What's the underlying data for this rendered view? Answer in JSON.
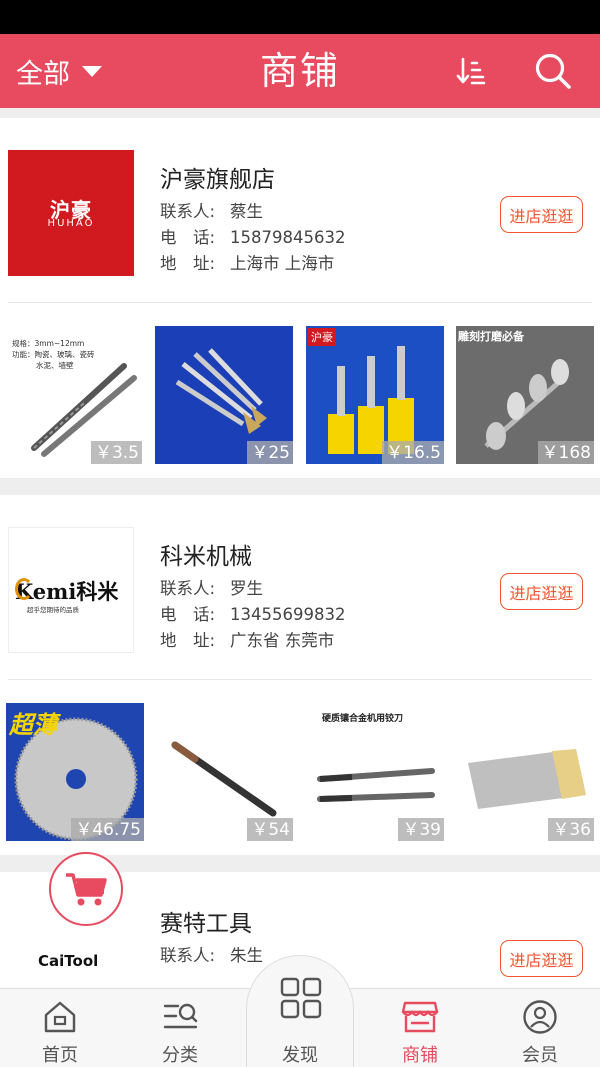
{
  "header": {
    "filter_label": "全部",
    "title": "商铺"
  },
  "colors": {
    "brand": "#e84a5f",
    "accent_orange": "#f0562f"
  },
  "shops": [
    {
      "name": "沪豪旗舰店",
      "logo_text": "沪豪",
      "logo_subtext": "HUHAO",
      "contact_label": "联系人:",
      "contact": "蔡生",
      "phone_label": "电　话:",
      "phone": "15879845632",
      "address_label": "地　址:",
      "address": "上海市 上海市",
      "enter_label": "进店逛逛",
      "products": [
        {
          "price": "￥3.5"
        },
        {
          "price": "￥25"
        },
        {
          "price": "￥16.5"
        },
        {
          "price": "￥168"
        }
      ]
    },
    {
      "name": "科米机械",
      "logo_text": "Kemi科米",
      "logo_subtext": "超乎您期待的品质",
      "contact_label": "联系人:",
      "contact": "罗生",
      "phone_label": "电　话:",
      "phone": "13455699832",
      "address_label": "地　址:",
      "address": "广东省 东莞市",
      "enter_label": "进店逛逛",
      "products": [
        {
          "price": "￥46.75"
        },
        {
          "price": "￥54"
        },
        {
          "price": "￥39"
        },
        {
          "price": "￥36"
        }
      ]
    },
    {
      "name": "赛特工具",
      "logo_text": "CaiTool",
      "contact_label": "联系人:",
      "contact": "朱生",
      "enter_label": "进店逛逛"
    }
  ],
  "product_captions": {
    "drill_spec_1": "规格：3mm~12mm",
    "drill_spec_2": "功能：陶瓷、玻璃、瓷砖",
    "drill_spec_3": "水泥、墙壁",
    "burr_banner": "雕刻打磨必备",
    "blade_banner": "超薄",
    "reamer_banner": "硬质镶合金机用铰刀"
  },
  "tabs": [
    {
      "label": "首页",
      "icon": "home-icon"
    },
    {
      "label": "分类",
      "icon": "category-icon"
    },
    {
      "label": "发现",
      "icon": "discover-icon"
    },
    {
      "label": "商铺",
      "icon": "shop-icon",
      "active": true
    },
    {
      "label": "会员",
      "icon": "member-icon"
    }
  ]
}
